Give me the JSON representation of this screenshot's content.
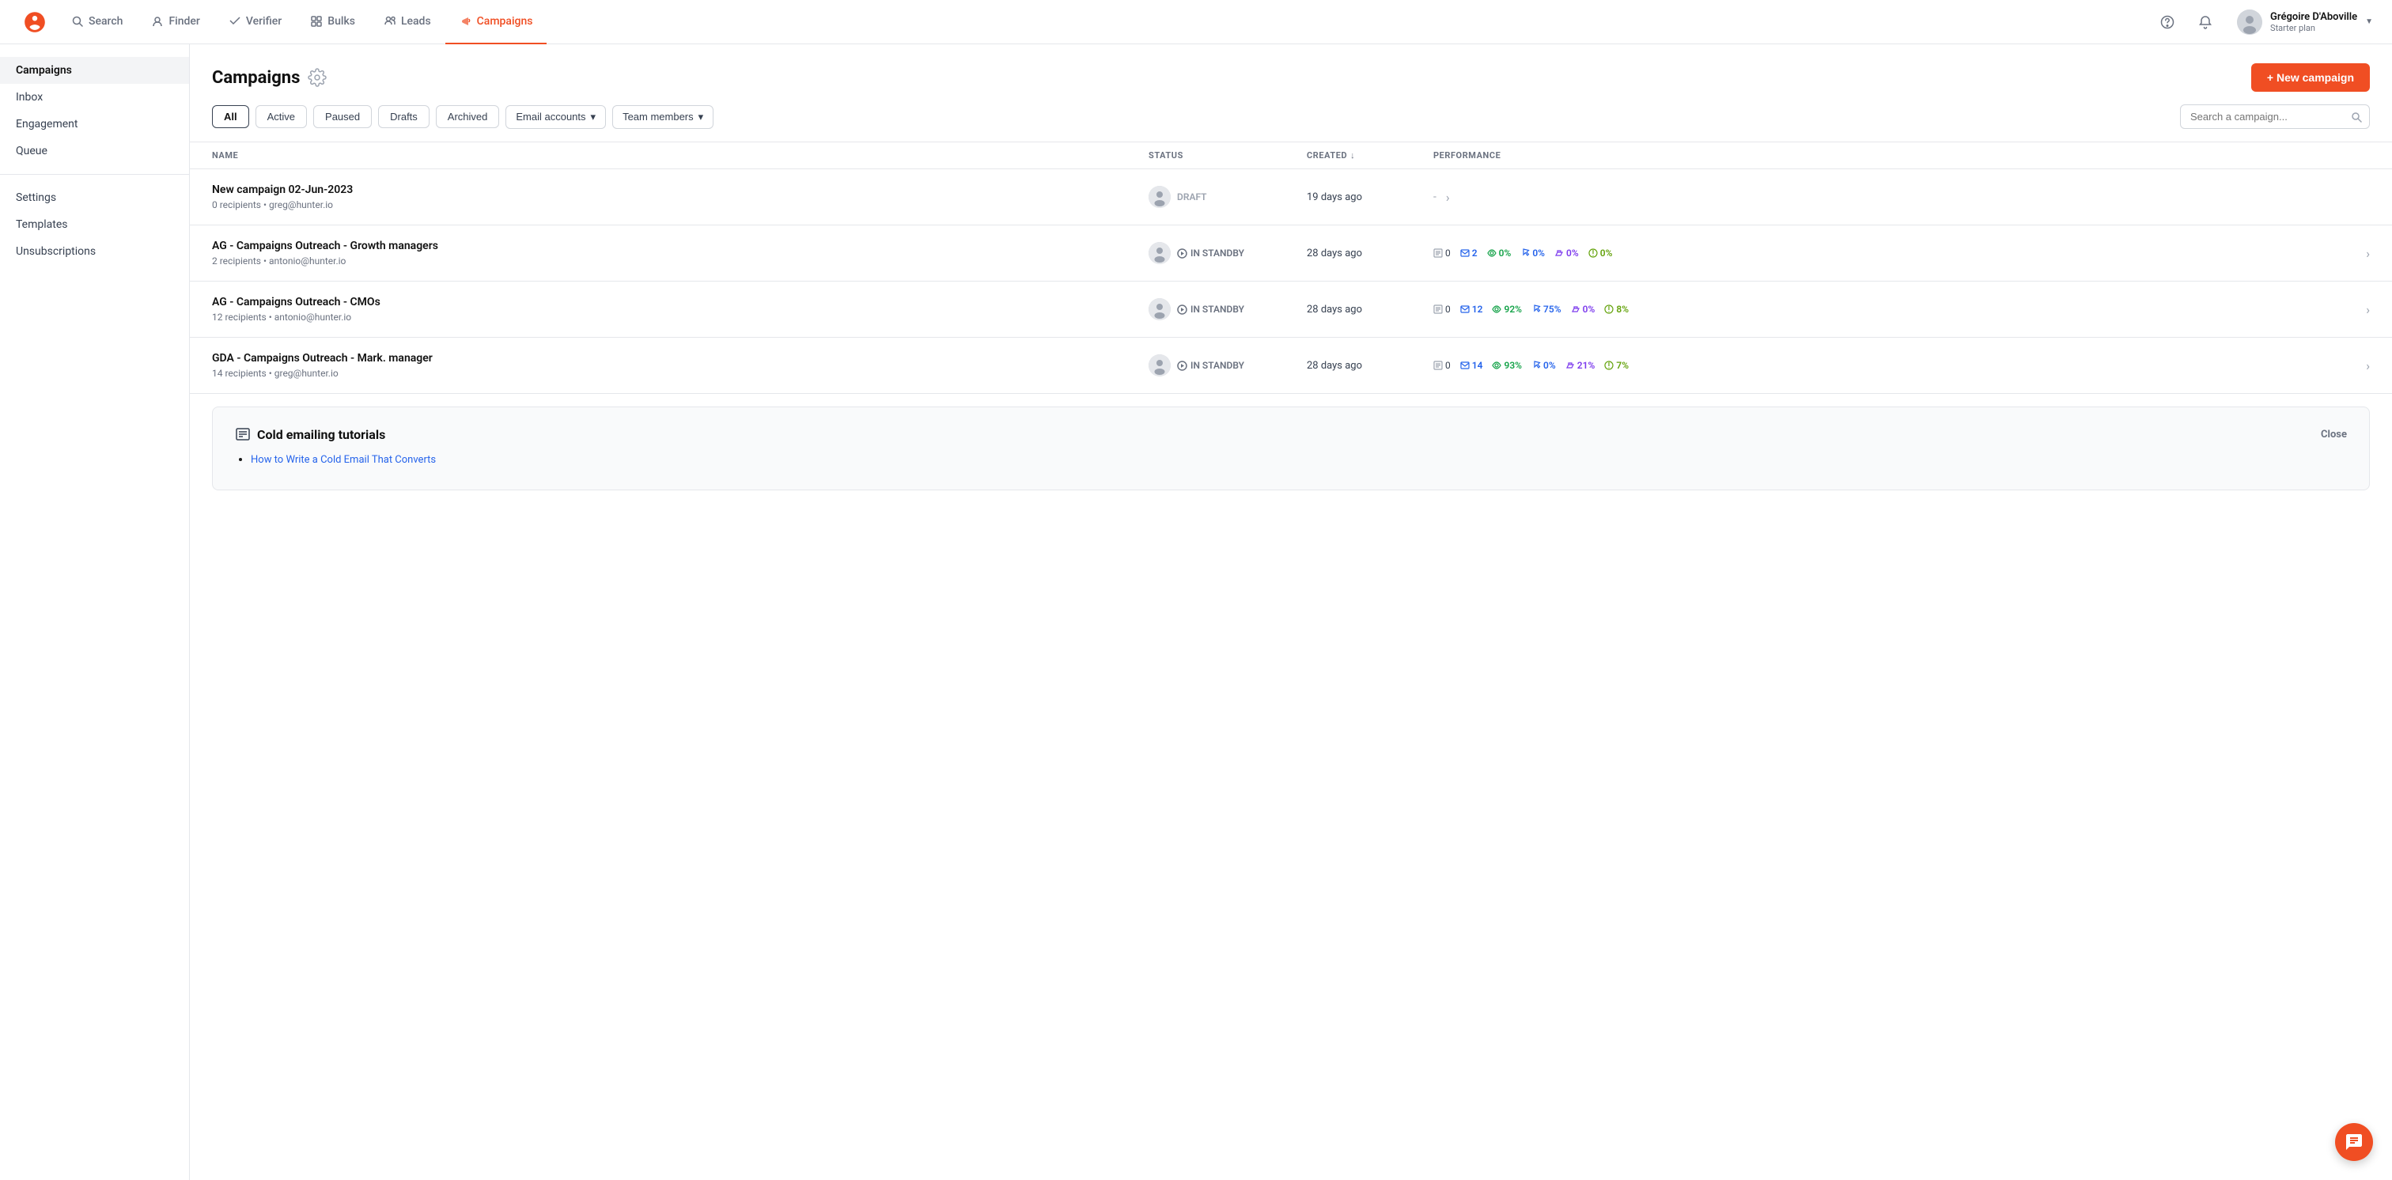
{
  "app": {
    "logo_alt": "Hunter.io"
  },
  "topnav": {
    "links": [
      {
        "id": "search",
        "label": "Search",
        "active": false
      },
      {
        "id": "finder",
        "label": "Finder",
        "active": false
      },
      {
        "id": "verifier",
        "label": "Verifier",
        "active": false
      },
      {
        "id": "bulks",
        "label": "Bulks",
        "active": false
      },
      {
        "id": "leads",
        "label": "Leads",
        "active": false
      },
      {
        "id": "campaigns",
        "label": "Campaigns",
        "active": true
      }
    ],
    "user": {
      "name": "Grégoire D'Aboville",
      "plan": "Starter plan"
    }
  },
  "sidebar": {
    "items": [
      {
        "id": "campaigns",
        "label": "Campaigns",
        "active": true
      },
      {
        "id": "inbox",
        "label": "Inbox",
        "active": false
      },
      {
        "id": "engagement",
        "label": "Engagement",
        "active": false
      },
      {
        "id": "queue",
        "label": "Queue",
        "active": false
      },
      {
        "id": "settings",
        "label": "Settings",
        "active": false
      },
      {
        "id": "templates",
        "label": "Templates",
        "active": false
      },
      {
        "id": "unsubscriptions",
        "label": "Unsubscriptions",
        "active": false
      }
    ]
  },
  "page": {
    "title": "Campaigns",
    "new_campaign_label": "+ New campaign"
  },
  "filters": {
    "all_label": "All",
    "active_label": "Active",
    "paused_label": "Paused",
    "drafts_label": "Drafts",
    "archived_label": "Archived",
    "email_accounts_label": "Email accounts",
    "team_members_label": "Team members",
    "search_placeholder": "Search a campaign..."
  },
  "table": {
    "headers": {
      "name": "NAME",
      "status": "STATUS",
      "created": "CREATED",
      "performance": "PERFORMANCE"
    },
    "rows": [
      {
        "id": "row1",
        "name": "New campaign 02-Jun-2023",
        "meta": "0 recipients • greg@hunter.io",
        "status": "DRAFT",
        "status_type": "draft",
        "created": "19 days ago",
        "performance_dash": "-"
      },
      {
        "id": "row2",
        "name": "AG - Campaigns Outreach - Growth managers",
        "meta": "2 recipients • antonio@hunter.io",
        "status": "IN STANDBY",
        "status_type": "standby",
        "created": "28 days ago",
        "perf": {
          "queued": "0",
          "sent": "2",
          "open": "0%",
          "click": "0%",
          "reply": "0%",
          "bounce": "0%"
        }
      },
      {
        "id": "row3",
        "name": "AG - Campaigns Outreach - CMOs",
        "meta": "12 recipients • antonio@hunter.io",
        "status": "IN STANDBY",
        "status_type": "standby",
        "created": "28 days ago",
        "perf": {
          "queued": "0",
          "sent": "12",
          "open": "92%",
          "click": "75%",
          "reply": "0%",
          "bounce": "8%"
        }
      },
      {
        "id": "row4",
        "name": "GDA - Campaigns Outreach - Mark. manager",
        "meta": "14 recipients • greg@hunter.io",
        "status": "IN STANDBY",
        "status_type": "standby",
        "created": "28 days ago",
        "perf": {
          "queued": "0",
          "sent": "14",
          "open": "93%",
          "click": "0%",
          "reply": "21%",
          "bounce": "7%"
        }
      }
    ]
  },
  "tutorial": {
    "title": "Cold emailing tutorials",
    "close_label": "Close",
    "links": [
      {
        "text": "How to Write a Cold Email That Converts",
        "href": "#"
      }
    ]
  }
}
